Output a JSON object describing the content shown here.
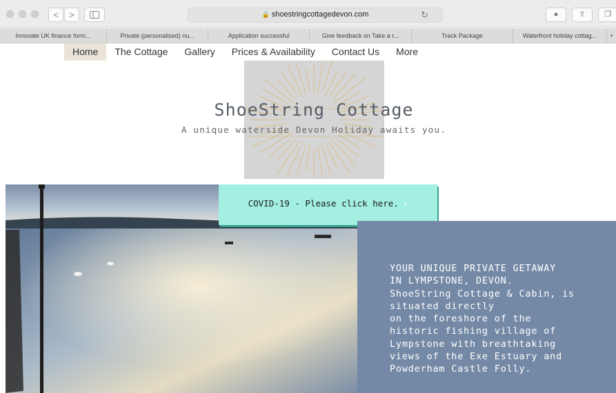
{
  "browser": {
    "url": "shoestringcottagedevon.com",
    "nav_back": "<",
    "nav_forward": ">",
    "tabs": [
      "Innovate UK finance form...",
      "Private (personalised) nu...",
      "Application successful",
      "Give feedback on Take a r...",
      "Track Package",
      "Waterfront holiday cottag..."
    ],
    "new_tab": "+"
  },
  "site": {
    "menu": [
      "Home",
      "The Cottage",
      "Gallery",
      "Prices & Availability",
      "Contact Us",
      "More"
    ],
    "active_menu": "Home",
    "title": "ShoeString Cottage",
    "tagline": "A unique waterside Devon Holiday awaits you.",
    "covid_button": "COVID-19 - Please click here.",
    "covid_chevron": "›",
    "info_lines": [
      "YOUR UNIQUE PRIVATE GETAWAY",
      "IN LYMPSTONE, DEVON.",
      "ShoeString Cottage & Cabin, is",
      "situated directly",
      "on the foreshore of the",
      "historic fishing village of",
      "Lympstone with breathtaking",
      "views of the Exe Estuary and",
      "Powderham Castle Folly."
    ]
  },
  "colors": {
    "accent_mint": "#a3efe1",
    "info_panel": "#7489a6",
    "menu_active": "#eae3d8",
    "sun_rays": "#d9b97a"
  }
}
